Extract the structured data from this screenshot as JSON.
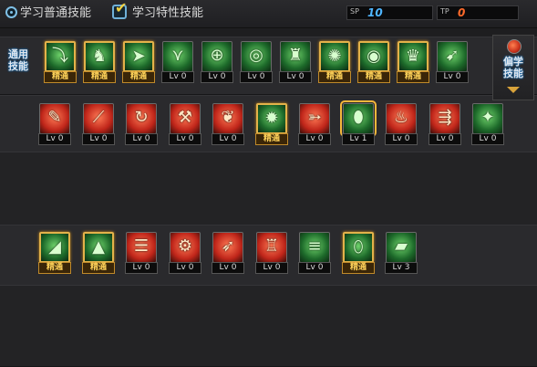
{
  "tabs": {
    "normal": "学习普通技能",
    "trait": "学习特性技能"
  },
  "points": {
    "sp_label": "SP",
    "sp_value": "10",
    "tp_label": "TP",
    "tp_value": "0"
  },
  "side": {
    "common_label": "通用\n技能",
    "class_label": "偏学\n技能"
  },
  "rows": [
    [
      {
        "level": "精通",
        "master": true,
        "color": "green",
        "icon": "fall-icon"
      },
      {
        "level": "精通",
        "master": true,
        "color": "green",
        "icon": "crouch-icon"
      },
      {
        "level": "精通",
        "master": true,
        "color": "green",
        "icon": "dash-icon"
      },
      {
        "level": "Lv 0",
        "master": false,
        "color": "green",
        "icon": "wings-icon"
      },
      {
        "level": "Lv 0",
        "master": false,
        "color": "green",
        "icon": "crosshair-icon"
      },
      {
        "level": "Lv 0",
        "master": false,
        "color": "green",
        "icon": "target-icon"
      },
      {
        "level": "Lv 0",
        "master": false,
        "color": "green",
        "icon": "soldier-icon"
      },
      {
        "level": "精通",
        "master": true,
        "color": "green",
        "icon": "shout-icon"
      },
      {
        "level": "精通",
        "master": true,
        "color": "green",
        "icon": "eye-icon"
      },
      {
        "level": "精通",
        "master": true,
        "color": "green",
        "icon": "fighter-icon"
      },
      {
        "level": "Lv 0",
        "master": false,
        "color": "green",
        "icon": "run-icon"
      }
    ],
    [
      {
        "level": "Lv 0",
        "master": false,
        "color": "red",
        "icon": "knife-icon"
      },
      {
        "level": "Lv 0",
        "master": false,
        "color": "red",
        "icon": "slash-icon"
      },
      {
        "level": "Lv 0",
        "master": false,
        "color": "red",
        "icon": "swing-icon"
      },
      {
        "level": "Lv 0",
        "master": false,
        "color": "red",
        "icon": "pick-icon"
      },
      {
        "level": "Lv 0",
        "master": false,
        "color": "red",
        "icon": "blade-icon"
      },
      {
        "level": "精通",
        "master": true,
        "color": "green",
        "icon": "burst-icon"
      },
      {
        "level": "Lv 0",
        "master": false,
        "color": "red",
        "icon": "bullet-icon"
      },
      {
        "level": "Lv 1",
        "master": false,
        "color": "green",
        "icon": "grenade-icon",
        "selected": true
      },
      {
        "level": "Lv 0",
        "master": false,
        "color": "red",
        "icon": "fire-icon"
      },
      {
        "level": "Lv 0",
        "master": false,
        "color": "red",
        "icon": "shot-icon"
      },
      {
        "level": "Lv 0",
        "master": false,
        "color": "green",
        "icon": "kick-icon"
      }
    ],
    [
      {
        "level": "精通",
        "master": true,
        "color": "green",
        "icon": "cannon-icon"
      },
      {
        "level": "精通",
        "master": true,
        "color": "green",
        "icon": "missile-icon"
      },
      {
        "level": "Lv 0",
        "master": false,
        "color": "red",
        "icon": "gatling-icon"
      },
      {
        "level": "Lv 0",
        "master": false,
        "color": "red",
        "icon": "gear-icon"
      },
      {
        "level": "Lv 0",
        "master": false,
        "color": "red",
        "icon": "rocket-icon"
      },
      {
        "level": "Lv 0",
        "master": false,
        "color": "red",
        "icon": "mech-icon"
      },
      {
        "level": "Lv 0",
        "master": false,
        "color": "green",
        "icon": "rail-icon"
      },
      {
        "level": "精通",
        "master": true,
        "color": "green",
        "icon": "flame-icon"
      },
      {
        "level": "Lv 3",
        "master": false,
        "color": "green",
        "icon": "bazooka-icon"
      }
    ]
  ],
  "colors": {
    "green": "#2f9a3a",
    "red": "#c0261a",
    "master_gold": "#e3b24a",
    "sp_blue": "#4fb6ff",
    "tp_orange": "#ff6a2a"
  }
}
